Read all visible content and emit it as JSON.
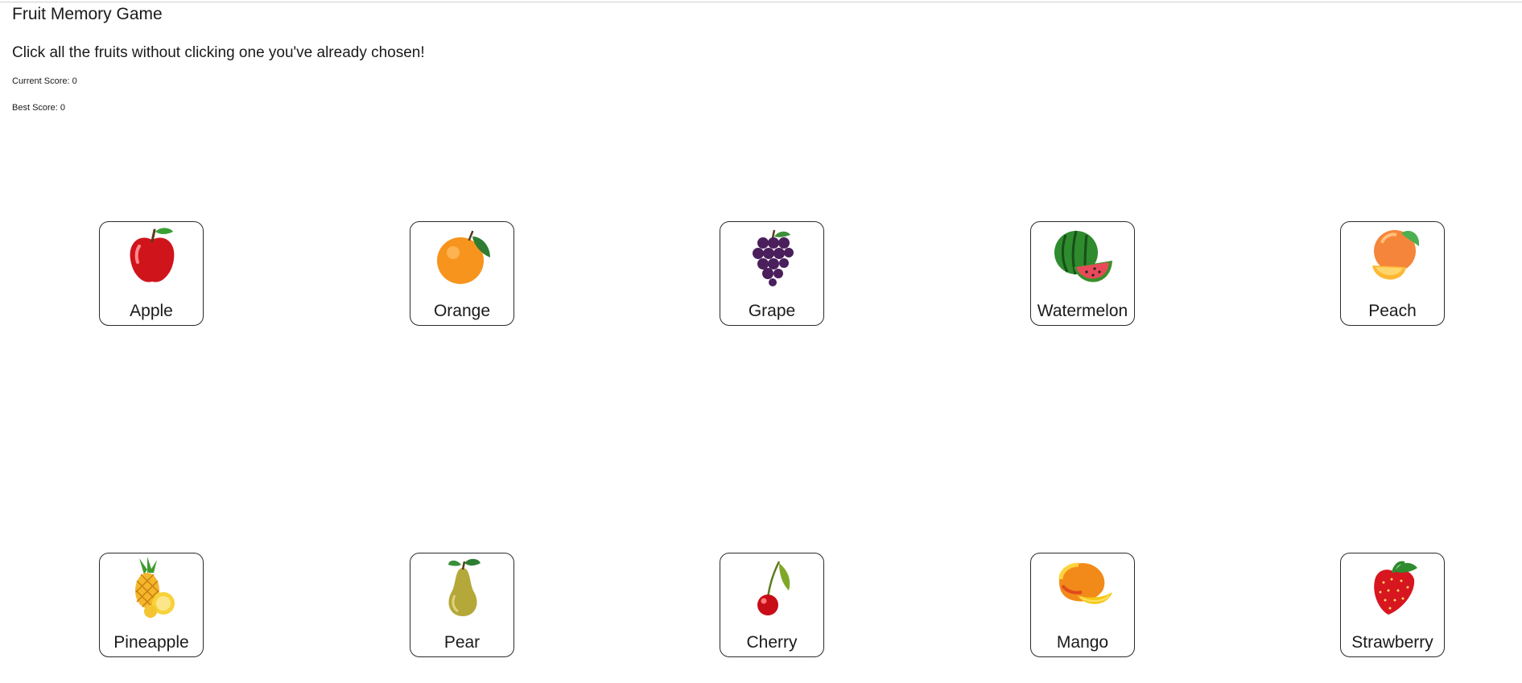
{
  "header": {
    "title": "Fruit Memory Game",
    "instructions": "Click all the fruits without clicking one you've already chosen!",
    "current_score_label": "Current Score: 0",
    "best_score_label": "Best Score: 0"
  },
  "fruits": [
    {
      "name": "Apple",
      "icon": "apple-icon"
    },
    {
      "name": "Orange",
      "icon": "orange-icon"
    },
    {
      "name": "Grape",
      "icon": "grape-icon"
    },
    {
      "name": "Watermelon",
      "icon": "watermelon-icon"
    },
    {
      "name": "Peach",
      "icon": "peach-icon"
    },
    {
      "name": "Pineapple",
      "icon": "pineapple-icon"
    },
    {
      "name": "Pear",
      "icon": "pear-icon"
    },
    {
      "name": "Cherry",
      "icon": "cherry-icon"
    },
    {
      "name": "Mango",
      "icon": "mango-icon"
    },
    {
      "name": "Strawberry",
      "icon": "strawberry-icon"
    }
  ]
}
